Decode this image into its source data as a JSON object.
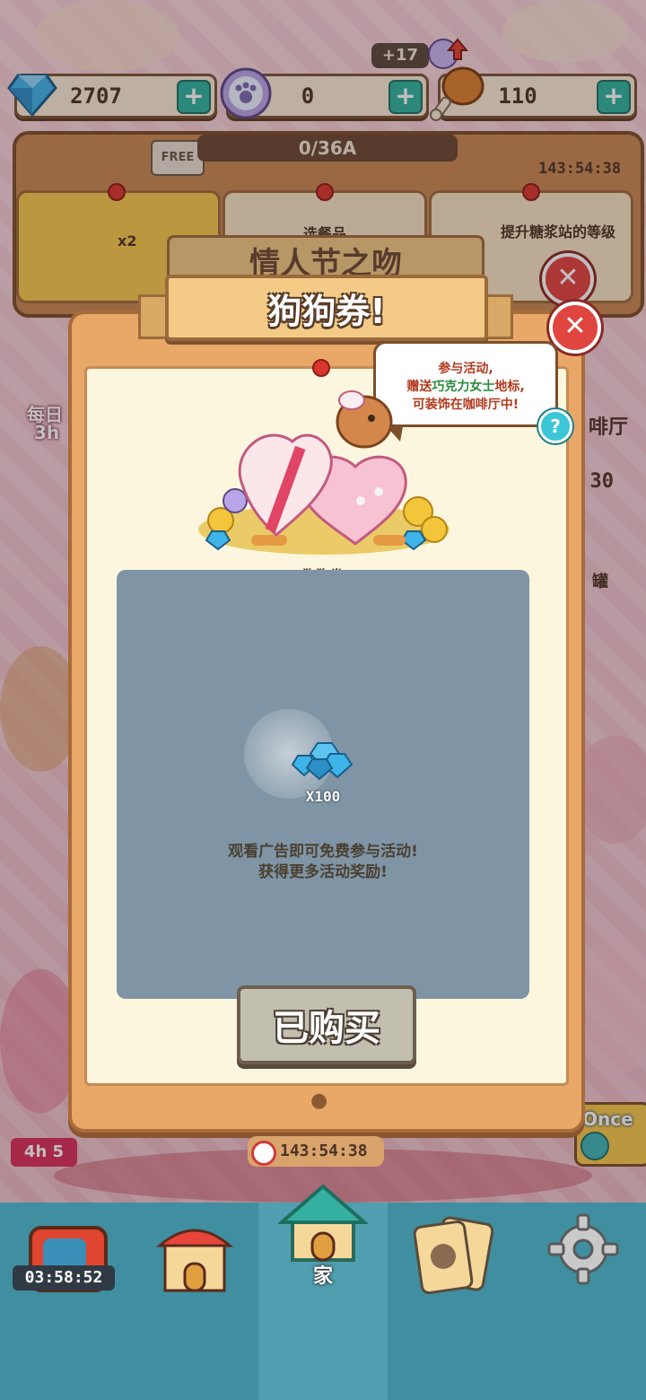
{
  "currency": {
    "gems": "2707",
    "tokens": "0",
    "food": "110",
    "food_bonus": "+17"
  },
  "board": {
    "free_label": "FREE",
    "progress": "0/36A",
    "timer": "143:54:38",
    "multiplier": "x2",
    "card_mid": "选餐品",
    "card_right": "提升糖浆站的等级"
  },
  "background": {
    "title": "情人节之吻",
    "left_label_1": "每日",
    "left_label_2": "3h",
    "right_label": "啡厅",
    "right_count": "30",
    "right_label_2": "罐",
    "left_timer": "4h 5",
    "once_label": "Once"
  },
  "modal": {
    "title": "狗狗券!",
    "bubble_line1": "参与活动,",
    "bubble_line2_pre": "赠送",
    "bubble_line2_green": "巧克力女士",
    "bubble_line2_post": "地标,",
    "bubble_line3": "可装饰在咖啡厅中!",
    "help": "?",
    "item_label": "狗狗券",
    "reward_count": "X100",
    "desc_line1": "观看广告即可免费参与活动!",
    "desc_line2": "获得更多活动奖励!",
    "bought_label": "已购买",
    "timer": "143:54:38"
  },
  "nav": {
    "timer": "03:58:52",
    "home_label": "家"
  },
  "colors": {
    "accent": "#2fb59f",
    "close": "#e04540",
    "nav": "#3f8fa0"
  }
}
